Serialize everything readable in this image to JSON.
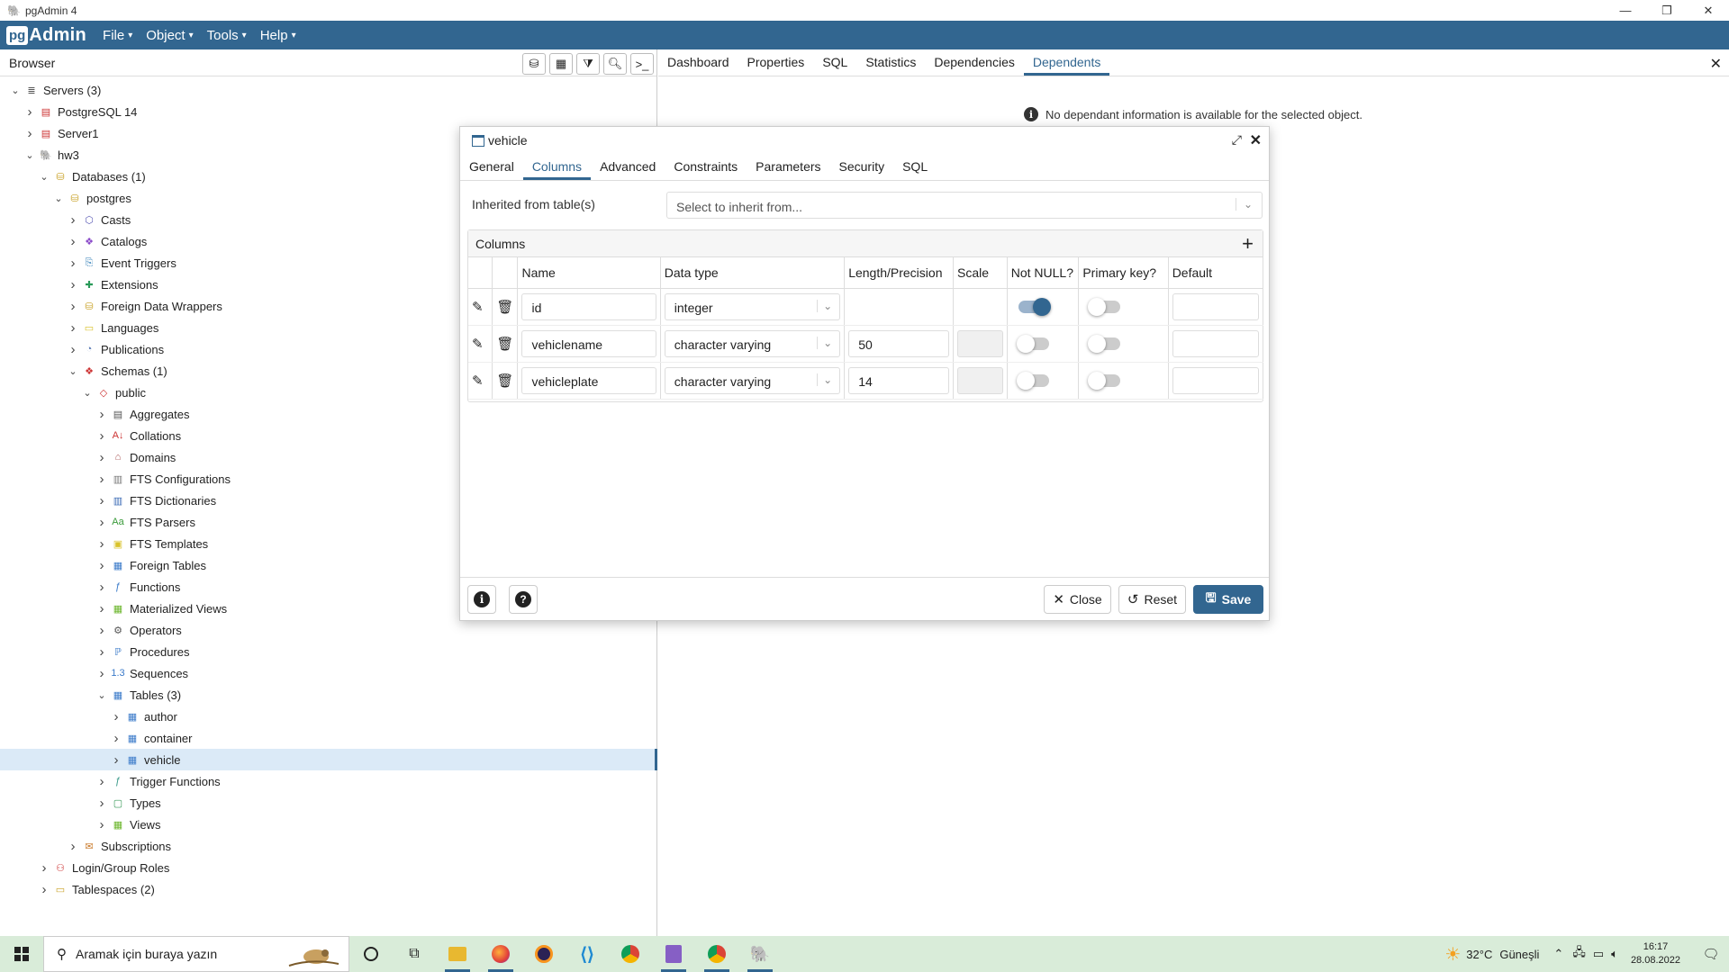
{
  "window": {
    "title": "pgAdmin 4",
    "minimize": "—",
    "maximize": "❐",
    "close": "✕"
  },
  "menubar": {
    "logo_pg": "pg",
    "logo_admin": "Admin",
    "items": [
      {
        "label": "File"
      },
      {
        "label": "Object"
      },
      {
        "label": "Tools"
      },
      {
        "label": "Help"
      }
    ]
  },
  "browser": {
    "title": "Browser",
    "tree": [
      {
        "label": "Servers (3)",
        "level": 0,
        "toggle": "v",
        "icon": "servers-icon"
      },
      {
        "label": "PostgreSQL 14",
        "level": 1,
        "toggle": ">",
        "icon": "server-disconnected-icon"
      },
      {
        "label": "Server1",
        "level": 1,
        "toggle": ">",
        "icon": "server-disconnected-icon"
      },
      {
        "label": "hw3",
        "level": 1,
        "toggle": "v",
        "icon": "server-icon"
      },
      {
        "label": "Databases (1)",
        "level": 2,
        "toggle": "v",
        "icon": "databases-icon"
      },
      {
        "label": "postgres",
        "level": 3,
        "toggle": "v",
        "icon": "database-icon"
      },
      {
        "label": "Casts",
        "level": 4,
        "toggle": ">",
        "icon": "casts-icon"
      },
      {
        "label": "Catalogs",
        "level": 4,
        "toggle": ">",
        "icon": "catalogs-icon"
      },
      {
        "label": "Event Triggers",
        "level": 4,
        "toggle": ">",
        "icon": "event-triggers-icon"
      },
      {
        "label": "Extensions",
        "level": 4,
        "toggle": ">",
        "icon": "extensions-icon"
      },
      {
        "label": "Foreign Data Wrappers",
        "level": 4,
        "toggle": ">",
        "icon": "foreign-data-wrappers-icon"
      },
      {
        "label": "Languages",
        "level": 4,
        "toggle": ">",
        "icon": "languages-icon"
      },
      {
        "label": "Publications",
        "level": 4,
        "toggle": ">",
        "icon": "publications-icon"
      },
      {
        "label": "Schemas (1)",
        "level": 4,
        "toggle": "v",
        "icon": "schemas-icon"
      },
      {
        "label": "public",
        "level": 5,
        "toggle": "v",
        "icon": "schema-icon"
      },
      {
        "label": "Aggregates",
        "level": 6,
        "toggle": ">",
        "icon": "aggregates-icon"
      },
      {
        "label": "Collations",
        "level": 6,
        "toggle": ">",
        "icon": "collations-icon"
      },
      {
        "label": "Domains",
        "level": 6,
        "toggle": ">",
        "icon": "domains-icon"
      },
      {
        "label": "FTS Configurations",
        "level": 6,
        "toggle": ">",
        "icon": "fts-configurations-icon"
      },
      {
        "label": "FTS Dictionaries",
        "level": 6,
        "toggle": ">",
        "icon": "fts-dictionaries-icon"
      },
      {
        "label": "FTS Parsers",
        "level": 6,
        "toggle": ">",
        "icon": "fts-parsers-icon"
      },
      {
        "label": "FTS Templates",
        "level": 6,
        "toggle": ">",
        "icon": "fts-templates-icon"
      },
      {
        "label": "Foreign Tables",
        "level": 6,
        "toggle": ">",
        "icon": "foreign-tables-icon"
      },
      {
        "label": "Functions",
        "level": 6,
        "toggle": ">",
        "icon": "functions-icon"
      },
      {
        "label": "Materialized Views",
        "level": 6,
        "toggle": ">",
        "icon": "materialized-views-icon"
      },
      {
        "label": "Operators",
        "level": 6,
        "toggle": ">",
        "icon": "operators-icon"
      },
      {
        "label": "Procedures",
        "level": 6,
        "toggle": ">",
        "icon": "procedures-icon"
      },
      {
        "label": "Sequences",
        "level": 6,
        "toggle": ">",
        "icon": "sequences-icon"
      },
      {
        "label": "Tables (3)",
        "level": 6,
        "toggle": "v",
        "icon": "tables-icon"
      },
      {
        "label": "author",
        "level": 7,
        "toggle": ">",
        "icon": "table-icon"
      },
      {
        "label": "container",
        "level": 7,
        "toggle": ">",
        "icon": "table-icon"
      },
      {
        "label": "vehicle",
        "level": 7,
        "toggle": ">",
        "icon": "table-icon",
        "selected": true
      },
      {
        "label": "Trigger Functions",
        "level": 6,
        "toggle": ">",
        "icon": "trigger-functions-icon"
      },
      {
        "label": "Types",
        "level": 6,
        "toggle": ">",
        "icon": "types-icon"
      },
      {
        "label": "Views",
        "level": 6,
        "toggle": ">",
        "icon": "views-icon"
      },
      {
        "label": "Subscriptions",
        "level": 4,
        "toggle": ">",
        "icon": "subscriptions-icon"
      },
      {
        "label": "Login/Group Roles",
        "level": 2,
        "toggle": ">",
        "icon": "login-roles-icon"
      },
      {
        "label": "Tablespaces (2)",
        "level": 2,
        "toggle": ">",
        "icon": "tablespaces-icon"
      }
    ]
  },
  "right_tabs": [
    {
      "label": "Dashboard"
    },
    {
      "label": "Properties"
    },
    {
      "label": "SQL"
    },
    {
      "label": "Statistics"
    },
    {
      "label": "Dependencies"
    },
    {
      "label": "Dependents",
      "active": true
    }
  ],
  "dependents_msg": "No dependant information is available for the selected object.",
  "dialog": {
    "title": "vehicle",
    "tabs": [
      {
        "label": "General"
      },
      {
        "label": "Columns",
        "active": true
      },
      {
        "label": "Advanced"
      },
      {
        "label": "Constraints"
      },
      {
        "label": "Parameters"
      },
      {
        "label": "Security"
      },
      {
        "label": "SQL"
      }
    ],
    "inherited_label": "Inherited from table(s)",
    "inherited_placeholder": "Select to inherit from...",
    "columns_title": "Columns",
    "headers": [
      "Name",
      "Data type",
      "Length/Precision",
      "Scale",
      "Not NULL?",
      "Primary key?",
      "Default"
    ],
    "rows": [
      {
        "name": "id",
        "type": "integer",
        "length": "",
        "scale": "",
        "not_null": true,
        "pk": false,
        "default": ""
      },
      {
        "name": "vehiclename",
        "type": "character varying",
        "length": "50",
        "scale": "",
        "not_null": false,
        "pk": false,
        "default": ""
      },
      {
        "name": "vehicleplate",
        "type": "character varying",
        "length": "14",
        "scale": "",
        "not_null": false,
        "pk": false,
        "default": ""
      }
    ],
    "buttons": {
      "close": "Close",
      "reset": "Reset",
      "save": "Save"
    }
  },
  "taskbar": {
    "search_placeholder": "Aramak için buraya yazın",
    "weather_temp": "32°C",
    "weather_desc": "Güneşli",
    "time": "16:17",
    "date": "28.08.2022",
    "apps": [
      "cortana-icon",
      "task-view-icon",
      "file-explorer-icon",
      "firefox-icon",
      "eclipse-icon",
      "vscode-icon",
      "chrome-icon",
      "visual-studio-icon",
      "chrome-profile-icon",
      "pgadmin-icon"
    ]
  },
  "colors": {
    "brand": "#326690",
    "selected_row": "#dbeaf7",
    "taskbar": "#d9ecd9"
  }
}
